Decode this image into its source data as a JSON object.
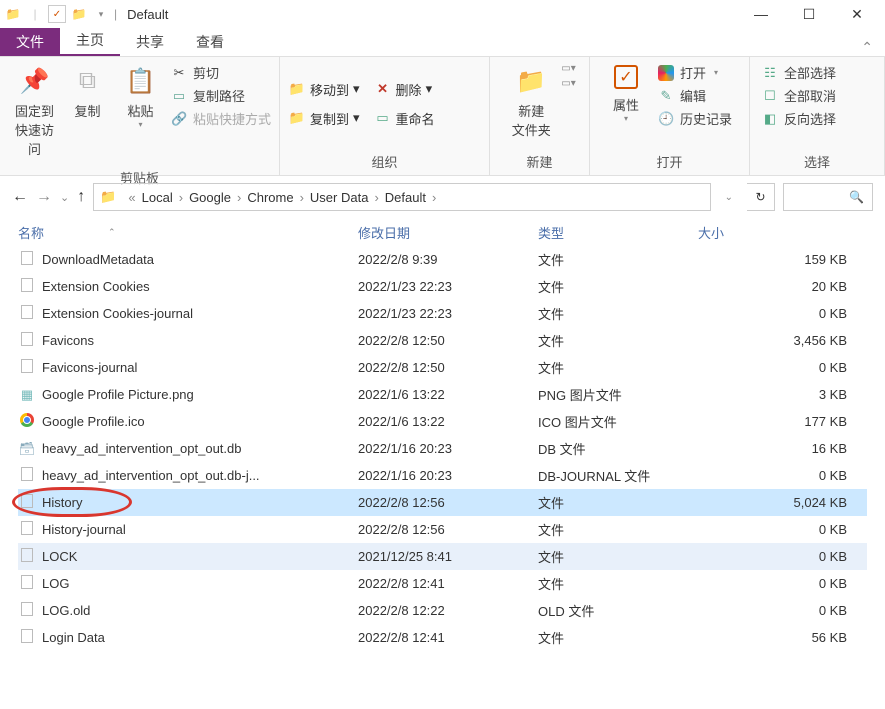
{
  "window": {
    "title": "Default"
  },
  "tabs": {
    "file": "文件",
    "home": "主页",
    "share": "共享",
    "view": "查看"
  },
  "ribbon": {
    "clipboard": {
      "label": "剪贴板",
      "pin": "固定到\n快速访问",
      "copy": "复制",
      "paste": "粘贴",
      "cut": "剪切",
      "copypath": "复制路径",
      "pasteshortcut": "粘贴快捷方式"
    },
    "organize": {
      "label": "组织",
      "moveto": "移动到",
      "copyto": "复制到",
      "delete": "删除",
      "rename": "重命名"
    },
    "new": {
      "label": "新建",
      "newfolder": "新建\n文件夹"
    },
    "open": {
      "label": "打开",
      "properties": "属性",
      "open": "打开",
      "edit": "编辑",
      "history": "历史记录"
    },
    "select": {
      "label": "选择",
      "selectall": "全部选择",
      "selectnone": "全部取消",
      "invert": "反向选择"
    }
  },
  "breadcrumb": {
    "prefix": "«",
    "parts": [
      "Local",
      "Google",
      "Chrome",
      "User Data",
      "Default"
    ]
  },
  "columns": {
    "name": "名称",
    "date": "修改日期",
    "type": "类型",
    "size": "大小"
  },
  "files": [
    {
      "icon": "doc",
      "name": "DownloadMetadata",
      "date": "2022/2/8 9:39",
      "type": "文件",
      "size": "159 KB"
    },
    {
      "icon": "doc",
      "name": "Extension Cookies",
      "date": "2022/1/23 22:23",
      "type": "文件",
      "size": "20 KB"
    },
    {
      "icon": "doc",
      "name": "Extension Cookies-journal",
      "date": "2022/1/23 22:23",
      "type": "文件",
      "size": "0 KB"
    },
    {
      "icon": "doc",
      "name": "Favicons",
      "date": "2022/2/8 12:50",
      "type": "文件",
      "size": "3,456 KB"
    },
    {
      "icon": "doc",
      "name": "Favicons-journal",
      "date": "2022/2/8 12:50",
      "type": "文件",
      "size": "0 KB"
    },
    {
      "icon": "png",
      "name": "Google Profile Picture.png",
      "date": "2022/1/6 13:22",
      "type": "PNG 图片文件",
      "size": "3 KB"
    },
    {
      "icon": "chrome",
      "name": "Google Profile.ico",
      "date": "2022/1/6 13:22",
      "type": "ICO 图片文件",
      "size": "177 KB"
    },
    {
      "icon": "db",
      "name": "heavy_ad_intervention_opt_out.db",
      "date": "2022/1/16 20:23",
      "type": "DB 文件",
      "size": "16 KB"
    },
    {
      "icon": "doc",
      "name": "heavy_ad_intervention_opt_out.db-j...",
      "date": "2022/1/16 20:23",
      "type": "DB-JOURNAL 文件",
      "size": "0 KB"
    },
    {
      "icon": "doc",
      "name": "History",
      "date": "2022/2/8 12:56",
      "type": "文件",
      "size": "5,024 KB",
      "selected": true,
      "circled": true
    },
    {
      "icon": "doc",
      "name": "History-journal",
      "date": "2022/2/8 12:56",
      "type": "文件",
      "size": "0 KB"
    },
    {
      "icon": "doc",
      "name": "LOCK",
      "date": "2021/12/25 8:41",
      "type": "文件",
      "size": "0 KB",
      "hilite": true
    },
    {
      "icon": "doc",
      "name": "LOG",
      "date": "2022/2/8 12:41",
      "type": "文件",
      "size": "0 KB"
    },
    {
      "icon": "doc",
      "name": "LOG.old",
      "date": "2022/2/8 12:22",
      "type": "OLD 文件",
      "size": "0 KB"
    },
    {
      "icon": "doc",
      "name": "Login Data",
      "date": "2022/2/8 12:41",
      "type": "文件",
      "size": "56 KB"
    }
  ]
}
